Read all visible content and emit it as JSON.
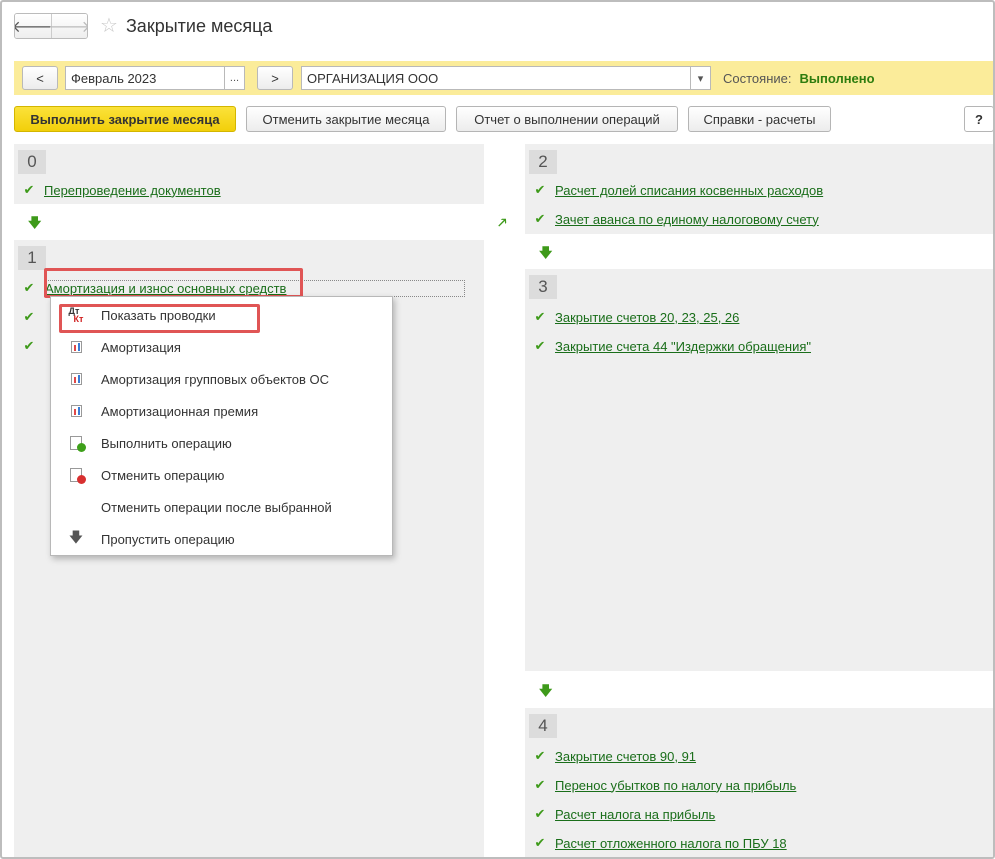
{
  "window": {
    "title": "Закрытие месяца"
  },
  "nav": {
    "back_glyph": "🡐",
    "forward_glyph": "🡒",
    "star_glyph": "☆"
  },
  "period": {
    "prev_label": "<",
    "next_label": ">",
    "value": "Февраль 2023",
    "picker_label": "...",
    "organization": "ОРГАНИЗАЦИЯ ООО",
    "org_dropdown_glyph": "▾",
    "status_label": "Состояние:",
    "status_value": "Выполнено",
    "status_color": "#2e7d0e"
  },
  "actions": {
    "run": "Выполнить закрытие месяца",
    "cancel": "Отменить закрытие месяца",
    "report": "Отчет о выполнении операций",
    "references": "Справки - расчеты",
    "help": "?"
  },
  "icons": {
    "check": "✔",
    "arrow_down": "🡇",
    "arrow_diag": "🡕"
  },
  "groups": [
    {
      "number": "0",
      "operations": [
        "Перепроведение документов"
      ]
    },
    {
      "number": "1",
      "operations": [
        "Амортизация и износ основных средств"
      ]
    },
    {
      "number": "2",
      "operations": [
        "Расчет долей списания косвенных расходов",
        "Зачет аванса по единому налоговому счету"
      ]
    },
    {
      "number": "3",
      "operations": [
        "Закрытие счетов 20, 23, 25, 26",
        "Закрытие счета 44 \"Издержки обращения\""
      ]
    },
    {
      "number": "4",
      "operations": [
        "Закрытие счетов 90, 91",
        "Перенос убытков по налогу на прибыль",
        "Расчет налога на прибыль",
        "Расчет отложенного налога по ПБУ 18"
      ]
    }
  ],
  "context_menu": {
    "items": [
      {
        "label": "Показать проводки",
        "icon": "dt-kt-icon",
        "dt": "Дт",
        "kt": "Кт"
      },
      {
        "label": "Амортизация",
        "icon": "report-icon"
      },
      {
        "label": "Амортизация групповых объектов ОС",
        "icon": "report-icon"
      },
      {
        "label": "Амортизационная премия",
        "icon": "report-icon"
      },
      {
        "label": "Выполнить операцию",
        "icon": "run-operation-icon"
      },
      {
        "label": "Отменить операцию",
        "icon": "cancel-operation-icon"
      },
      {
        "label": "Отменить операции после выбранной",
        "icon": ""
      },
      {
        "label": "Пропустить операцию",
        "icon": "skip-arrow-icon",
        "glyph": "🡇"
      }
    ]
  }
}
